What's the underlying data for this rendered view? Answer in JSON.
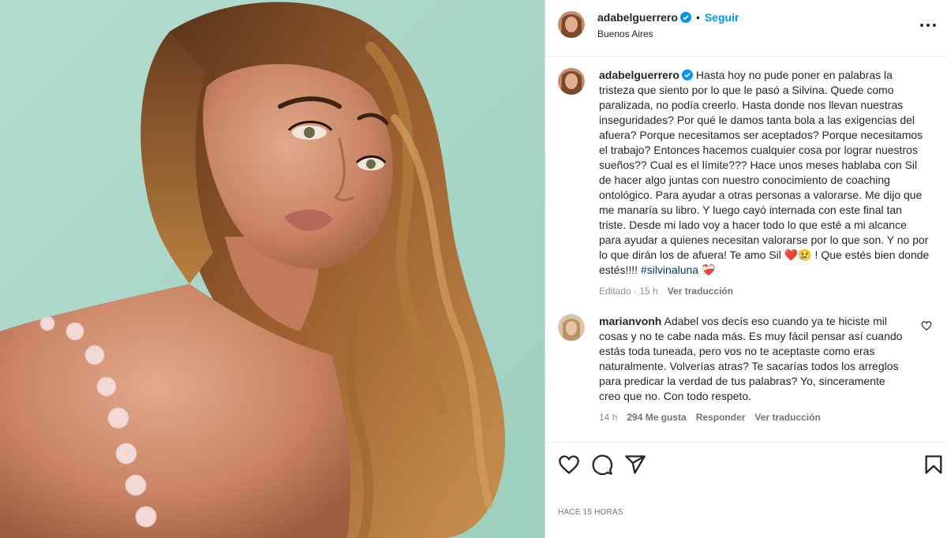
{
  "post": {
    "username": "adabelguerrero",
    "separator": "•",
    "follow_label": "Seguir",
    "location": "Buenos Aires",
    "more_icon": "more-horizontal-icon"
  },
  "caption": {
    "username": "adabelguerrero",
    "text_part1": "Hasta hoy no pude poner en palabras la tristeza que siento por lo que le pasó a Silvina. Quede como paralizada, no podía creerlo. Hasta donde nos llevan nuestras inseguridades? Por qué le damos tanta bola a las exigencias del afuera? Porque necesitamos ser aceptados? Porque necesitamos el trabajo? Entonces hacemos cualquier cosa por lograr nuestros sueños?? Cual es el límite??? Hace unos meses hablaba con Sil de hacer algo juntas con nuestro conocimiento de coaching ontológico. Para ayudar a otras personas a valorarse. Me dijo que me manaría su libro. Y luego cayó internada con este final tan triste. Desde mi lado voy a hacer todo lo que esté a mi alcance para ayudar a quienes necesitan valorarse por lo que son. Y no por lo que dirán los de afuera! Te amo Sil",
    "emoji1": "❤️",
    "emoji2": "😢",
    "text_part2": "! Que estés bien donde estés!!!!",
    "hashtag": "#silvinaluna",
    "emoji3": "❤️‍🩹",
    "meta_edited": "Editado · 15 h",
    "translate": "Ver traducción"
  },
  "comment": {
    "username": "marianvonh",
    "text": "Adabel vos decís eso cuando ya te hiciste mil cosas y no te cabe nada más. Es muy fácil pensar así cuando estás toda tuneada, pero vos no te aceptaste como eras naturalmente. Volverías atras? Te sacarías todos los arreglos para predicar la verdad de tus palabras? Yo, sinceramente creo que no. Con todo respeto.",
    "time": "14 h",
    "likes": "294 Me gusta",
    "reply": "Responder",
    "translate": "Ver traducción"
  },
  "actions": {
    "like_icon": "heart-icon",
    "comment_icon": "comment-icon",
    "share_icon": "share-icon",
    "save_icon": "bookmark-icon"
  },
  "time_ago": "HACE 15 HORAS",
  "colors": {
    "link_blue": "#0095f6",
    "hashtag_blue": "#00376b",
    "photo_bg": "#a8d5c5",
    "text": "#262626",
    "muted": "#737373"
  }
}
